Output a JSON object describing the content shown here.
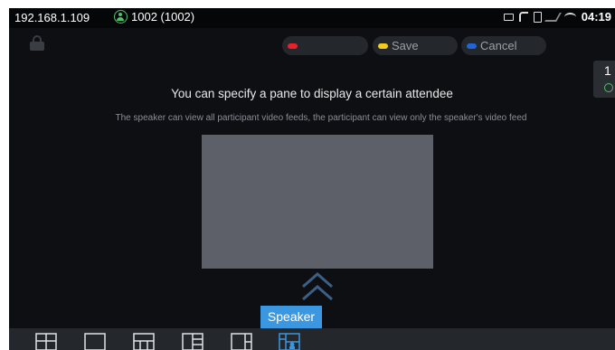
{
  "status": {
    "ip": "192.168.1.109",
    "account": "1002 (1002)",
    "time": "04:19"
  },
  "toolbar": {
    "red_label": "",
    "save_label": "Save",
    "cancel_label": "Cancel",
    "colors": {
      "red": "#e8212b",
      "save": "#f2cc1b",
      "cancel": "#2064d6"
    }
  },
  "sidetab": {
    "number": "1"
  },
  "main": {
    "headline": "You can specify a pane to display a certain attendee",
    "subline": "The speaker can view all participant video feeds, the participant can view only the speaker's video feed"
  },
  "layouts": {
    "tooltip": "Speaker",
    "items": [
      "layout-quad",
      "layout-single",
      "layout-grid-1",
      "layout-grid-2",
      "layout-side",
      "layout-speaker"
    ],
    "selected": "layout-speaker"
  },
  "colors": {
    "accent": "#3b97e0",
    "background": "#0d0f12",
    "status_green": "#4fc16a"
  }
}
